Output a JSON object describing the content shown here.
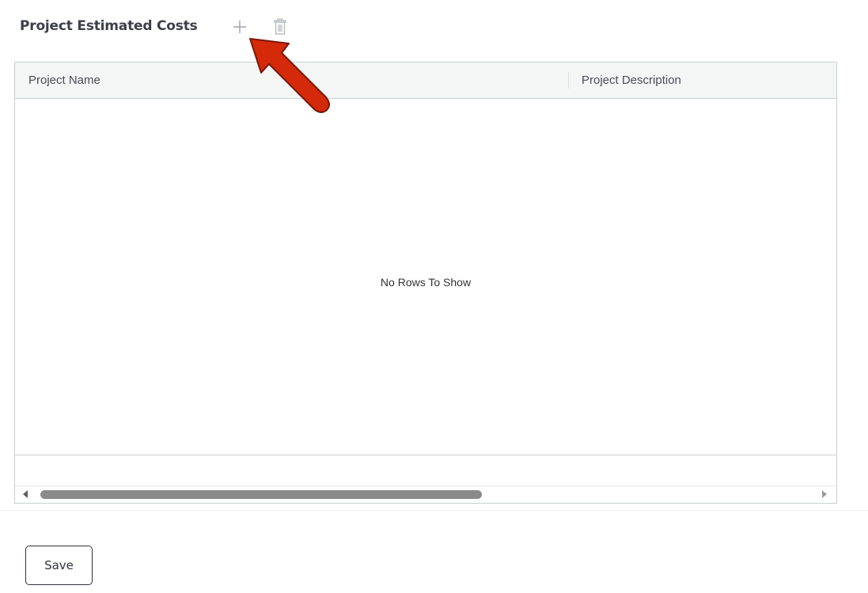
{
  "section": {
    "title": "Project Estimated Costs",
    "add_icon": "plus-icon",
    "delete_icon": "trash-icon"
  },
  "grid": {
    "columns": [
      "Project Name",
      "Project Description"
    ],
    "rows": [],
    "empty_message": "No Rows To Show"
  },
  "footer": {
    "save_label": "Save"
  },
  "colors": {
    "title": "#3d3f4a",
    "header_bg": "#f4f6f6",
    "border": "#c9cfd2",
    "scroll_thumb": "#8a8a8a",
    "annotation_arrow": "#d42a0a"
  }
}
